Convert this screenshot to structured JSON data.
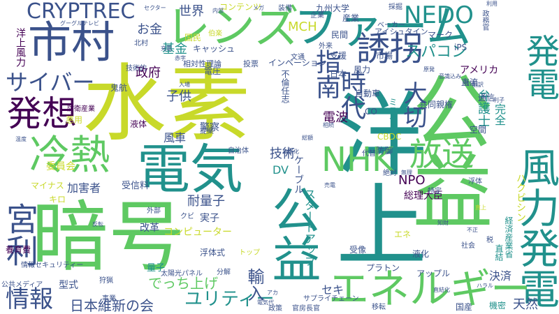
{
  "cloud": {
    "palette": {
      "yellow": "#c8d92a",
      "green": "#5ec962",
      "teal": "#21918c",
      "blue": "#3b528b",
      "purple": "#440154"
    },
    "words": [
      "水素",
      "暗号",
      "洋上",
      "電気",
      "冷熱",
      "公益",
      "市村",
      "レンズ",
      "ファーム",
      "エネルギー",
      "放送",
      "NHK",
      "発電",
      "発想",
      "誘拐",
      "風力発電",
      "宮利",
      "大切",
      "CRYPTREC",
      "NEDO",
      "サイバー",
      "指南",
      "時代",
      "情報",
      "スパコン",
      "日本維新の会",
      "ユリティー",
      "でっち上げ",
      "輸入",
      "世界",
      "お金",
      "MCH",
      "基金",
      "政府",
      "子供",
      "技術",
      "耐量子",
      "NPO",
      "風車",
      "電波",
      "警察",
      "弁護士",
      "完全",
      "決済",
      "天然",
      "国産",
      "機密",
      "アメリカ",
      "自動車",
      "共同親権",
      "通信",
      "空間",
      "防御",
      "総理大臣",
      "加害者",
      "受信料",
      "マイナス",
      "キロ",
      "改革",
      "実子",
      "クビ",
      "量子",
      "浮体式",
      "型式",
      "セキ",
      "民間",
      "九州大学",
      "コンテンツ",
      "産業",
      "市場",
      "支援",
      "日本",
      "液化",
      "アップル",
      "プラトン",
      "受像",
      "風力",
      "電圧",
      "液体",
      "委員会",
      "養育費",
      "洋上風力",
      "DV",
      "ケーブル",
      "直流",
      "アイシュタイン",
      "ハクビシン",
      "経済産業省",
      "直結",
      "スタートアップ",
      "コンピューター",
      "情報セキュリティー",
      "太陽光パネル",
      "公共メディア",
      "インベーション",
      "相対性理論",
      "投票",
      "不倫任志",
      "キャッシュ",
      "技術的",
      "鬼航",
      "防衛産業",
      "悪用",
      "国民",
      "伯楽",
      "ミスター",
      "エネ",
      "CO",
      "CBDC",
      "iPS",
      "マーク",
      "文通",
      "外部",
      "狩猟",
      "事業",
      "分解",
      "官房長官",
      "政策",
      "サプライチェーン",
      "移転",
      "トップ",
      "提案",
      "自治体",
      "絶対",
      "代替",
      "特定",
      "税",
      "社会",
      "浮体",
      "外来",
      "ベーカー",
      "グーグルテレビ",
      "セクター",
      "装備",
      "企業",
      "採掘",
      "政務官",
      "利用",
      "利子",
      "翻訳",
      "直上",
      "温度",
      "反転",
      "内部",
      "北村",
      "充電",
      "メガ",
      "相続",
      "無理",
      "事業化",
      "強化",
      "入場",
      "売電",
      "赤字",
      "アカ",
      "電気代",
      "原発",
      "意識込み",
      "総額",
      "知財",
      "ハラル",
      "直結化",
      "不正",
      "回収",
      "フェイス"
    ]
  }
}
